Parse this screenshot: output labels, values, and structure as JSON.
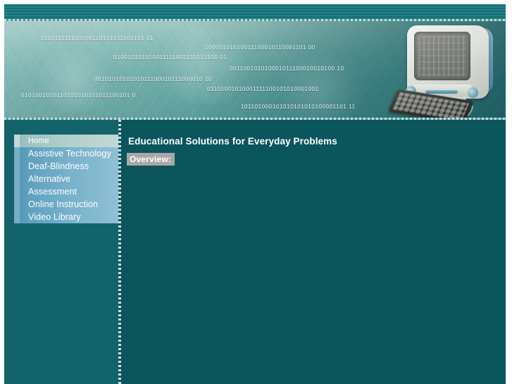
{
  "site": {
    "banner_alt": "computer-banner-image",
    "binary_lines": [
      "011011011100000110101011100101 01",
      "10000101010011100010110001101 00",
      "010010101010011111001101010100 01",
      "001100101010001011100010010100 10",
      "0010101010101011100010111000010 10",
      "01101001010001111100101010001001",
      "0101001010110101010101011100101 0",
      "101101000101010101010100001101 11"
    ]
  },
  "sidebar": {
    "items": [
      {
        "label": "Home",
        "active": true
      },
      {
        "label": "Assistive Technology",
        "active": false
      },
      {
        "label": "Deaf-Blindness",
        "active": false
      },
      {
        "label": "Alternative",
        "active": false
      },
      {
        "label": "Assessment",
        "active": false
      },
      {
        "label": "Online Instruction",
        "active": false
      },
      {
        "label": "Video Library",
        "active": false
      }
    ]
  },
  "main": {
    "title": "Educational Solutions for Everyday Problems",
    "overview_label": "Overview:"
  },
  "colors": {
    "page_background": "#0b555d",
    "sidebar_background": "#13636b",
    "nav_item": "#79b2cb",
    "nav_item_active": "#b2d0cd",
    "top_stripe": "#1d7b80",
    "highlight": "#a8a8a8",
    "text": "#ffffff"
  }
}
